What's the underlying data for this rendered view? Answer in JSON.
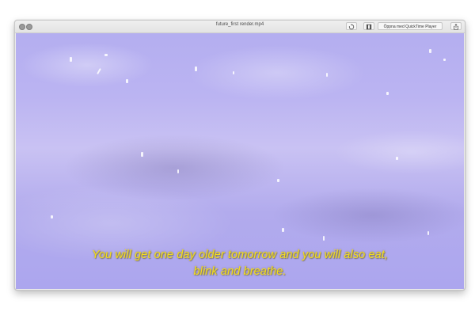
{
  "window": {
    "title": "future_first render.mp4"
  },
  "toolbar": {
    "rotate_icon": "rotate-icon",
    "trim_icon": "trim-icon",
    "open_with_label": "Öppna med QuickTime Player",
    "share_icon": "share-icon"
  },
  "video": {
    "subtitle_line_1": "You will get one day older tomorrow and you will also eat,",
    "subtitle_line_2": "blink and breathe.",
    "subtitle_color": "#f2dc1e",
    "background_color": "#b8b2f0"
  }
}
